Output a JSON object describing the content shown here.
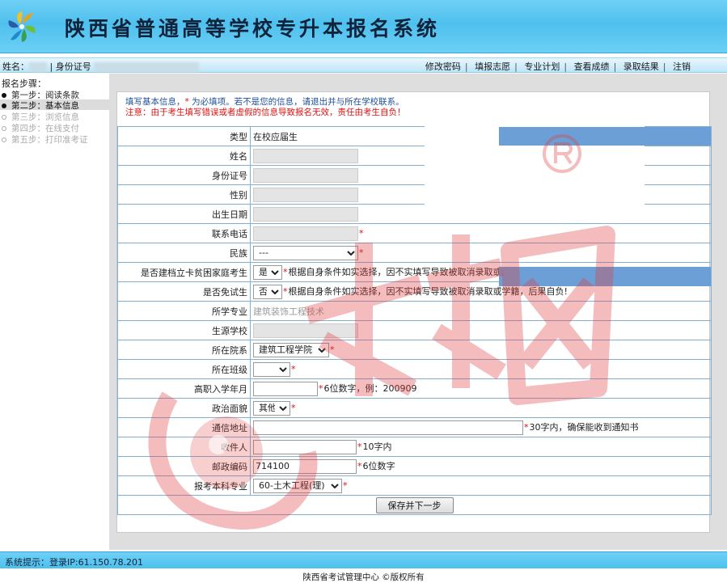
{
  "header": {
    "title": "陕西省普通高等学校专升本报名系统"
  },
  "userbar": {
    "name_label": "姓名：",
    "id_label": "| 身份证号",
    "menu": [
      "修改密码",
      "填报志愿",
      "专业计划",
      "查看成绩",
      "录取结果",
      "注销"
    ]
  },
  "sidebar": {
    "title": "报名步骤：",
    "steps": [
      "第一步：阅读条款",
      "第二步：基本信息",
      "第三步：浏览信息",
      "第四步：在线支付",
      "第五步：打印准考证"
    ]
  },
  "notes": {
    "line1_a": "填写基本信息，",
    "line1_star": "*",
    "line1_b": " 为必填项。若不是您的信息，请退出并与所在学校联系。",
    "line2": "注意：由于考生填写错误或者虚假的信息导致报名无效，责任由考生自负！"
  },
  "form": {
    "type_label": "类型",
    "type_value": "在校应届生",
    "name_label": "姓名",
    "id_label": "身份证号",
    "gender_label": "性别",
    "birth_label": "出生日期",
    "phone_label": "联系电话",
    "ethnic_label": "民族",
    "ethnic_value": "---",
    "poverty_label": "是否建档立卡贫困家庭考生",
    "poverty_value": "是",
    "exempt_label": "是否免试生",
    "exempt_value": "否",
    "choice_hint": "根据自身条件如实选择，因不实填写导致被取消录取或学籍，后果自负!",
    "major_label": "所学专业",
    "major_value": "建筑装饰工程技术",
    "school_label": "生源学校",
    "dept_label": "所在院系",
    "dept_value": "建筑工程学院",
    "class_label": "所在班级",
    "enroll_label": "高职入学年月",
    "enroll_hint": "6位数字，例：200909",
    "politics_label": "政治面貌",
    "politics_value": "其他",
    "address_label": "通信地址",
    "address_hint": "30字内，确保能收到通知书",
    "recipient_label": "收件人",
    "recipient_hint": "10字内",
    "postcode_label": "邮政编码",
    "postcode_value": "714100",
    "postcode_hint": "6位数字",
    "target_label": "报考本科专业",
    "target_value": "60-土木工程(理)",
    "submit_label": "保存并下一步"
  },
  "status": {
    "text": "系统提示：登录IP:61.150.78.201"
  },
  "footer": {
    "text": "陕西省考试管理中心 ©版权所有"
  },
  "colors": {
    "header": "#4fc0ee",
    "required": "#e01010",
    "table_border": "#7fb0d8",
    "photo_bar": "#6b9fd6",
    "watermark": "#e04040"
  }
}
